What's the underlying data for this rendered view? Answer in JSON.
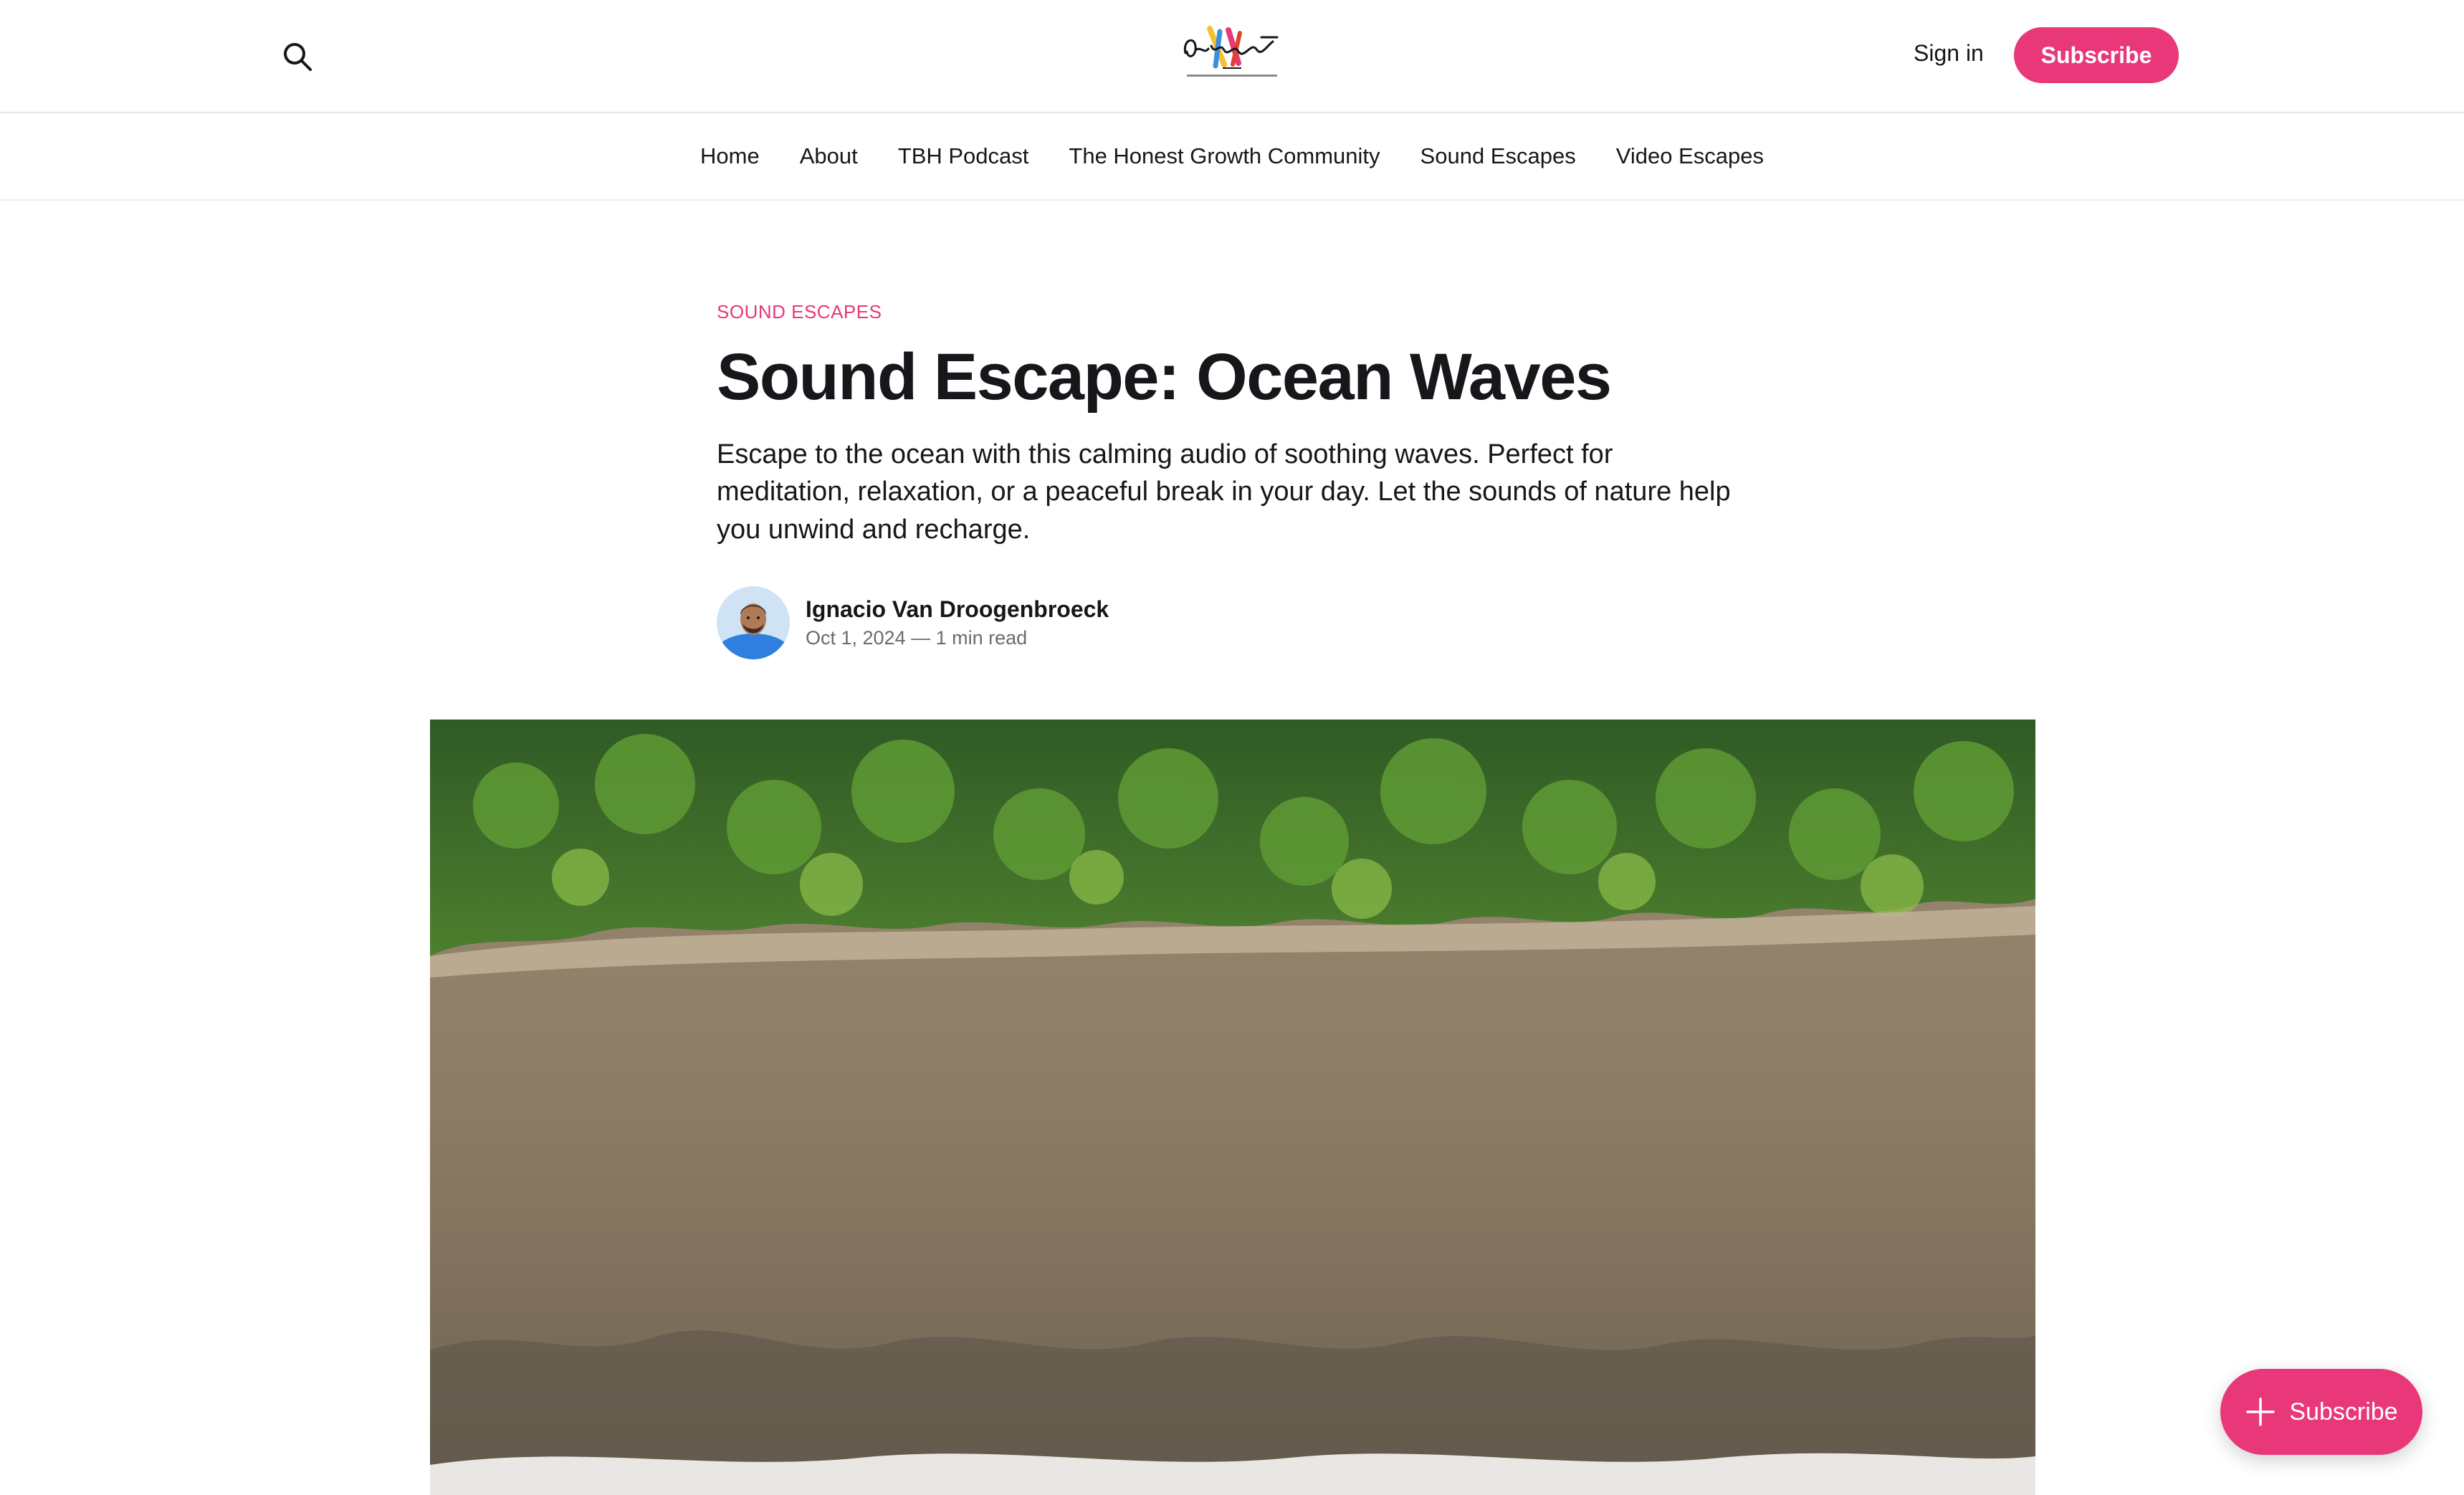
{
  "header": {
    "sign_in_label": "Sign in",
    "subscribe_label": "Subscribe",
    "accent_color": "#e8387a",
    "icons": {
      "search": "search-icon"
    }
  },
  "nav": {
    "items": [
      {
        "label": "Home"
      },
      {
        "label": "About"
      },
      {
        "label": "TBH Podcast"
      },
      {
        "label": "The Honest Growth Community"
      },
      {
        "label": "Sound Escapes"
      },
      {
        "label": "Video Escapes"
      }
    ]
  },
  "article": {
    "tag": "SOUND ESCAPES",
    "title": "Sound Escape: Ocean Waves",
    "excerpt": "Escape to the ocean with this calming audio of soothing waves. Perfect for meditation, relaxation, or a peaceful break in your day. Let the sounds of nature help you unwind and recharge.",
    "author": "Ignacio Van Droogenbroeck",
    "date_read": "Oct 1, 2024 — 1 min read"
  },
  "floating_subscribe": {
    "label": "Subscribe",
    "icon": "plus-icon"
  }
}
